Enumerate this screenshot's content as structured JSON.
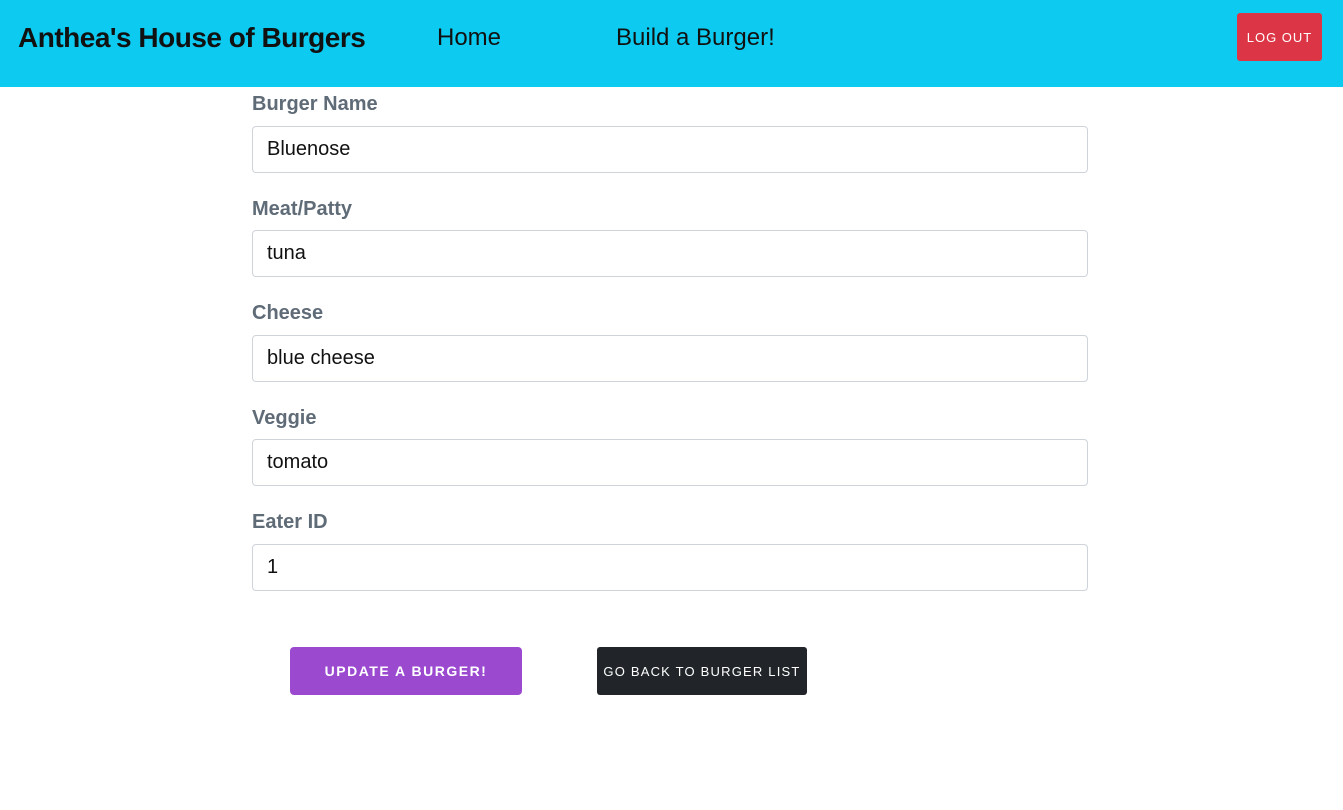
{
  "navbar": {
    "brand": "Anthea's House of Burgers",
    "links": [
      "Home",
      "Build a Burger!"
    ],
    "logout_label": "Log Out",
    "background": "#0dcaf0",
    "logout_color": "#dc3545"
  },
  "form": {
    "fields": [
      {
        "label": "Burger Name",
        "value": "Bluenose"
      },
      {
        "label": "Meat/Patty",
        "value": "tuna"
      },
      {
        "label": "Cheese",
        "value": "blue cheese"
      },
      {
        "label": "Veggie",
        "value": "tomato"
      },
      {
        "label": "Eater ID",
        "value": "1"
      }
    ],
    "submit_label": "Update a Burger!",
    "back_label": "Go Back to Burger List",
    "submit_color": "#9b4ad0",
    "back_color": "#212529"
  }
}
